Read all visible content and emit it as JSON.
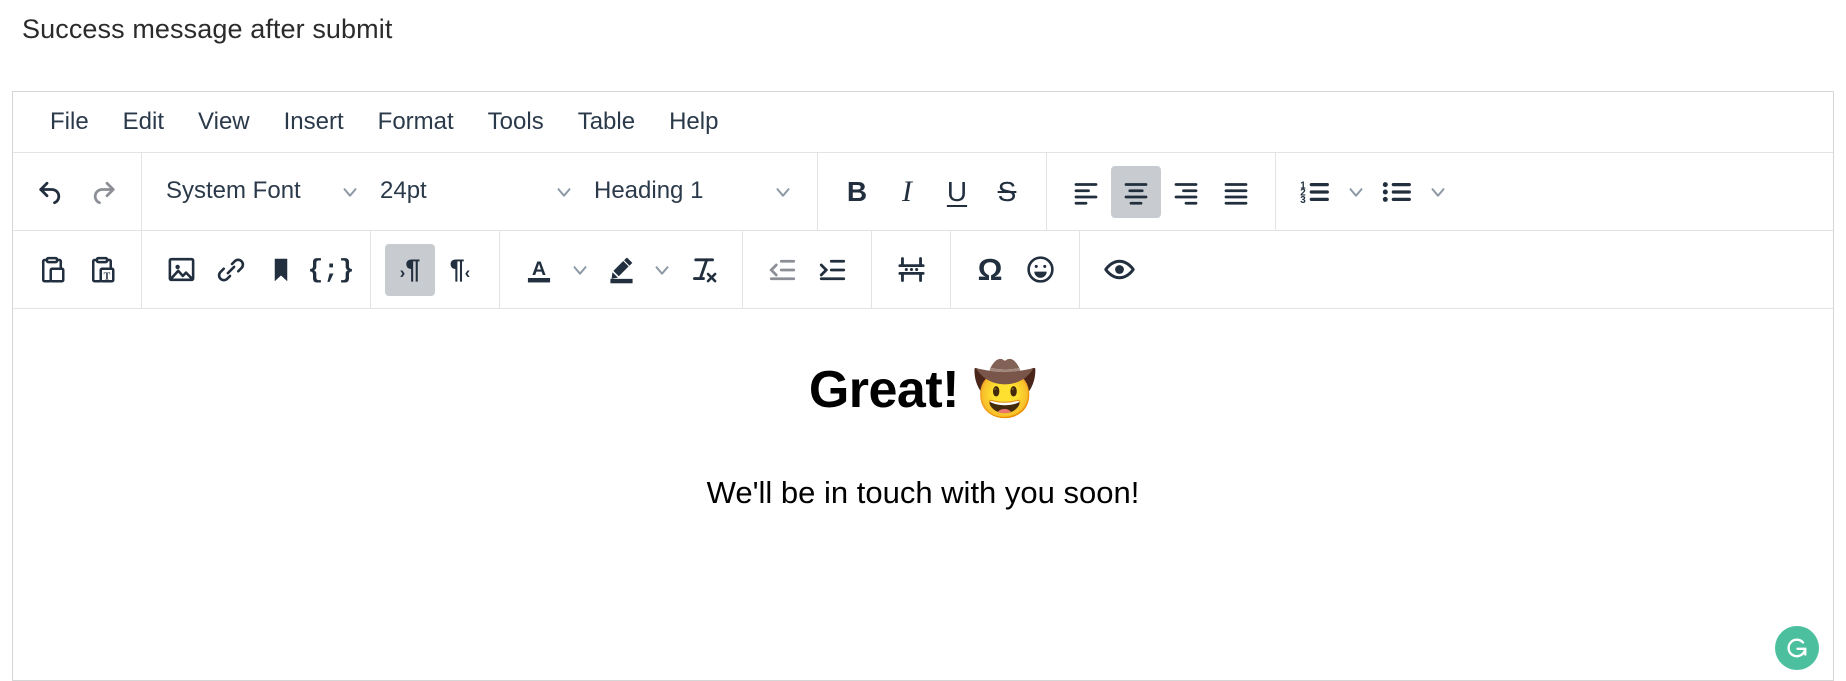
{
  "page": {
    "title": "Success message after submit"
  },
  "menubar": {
    "items": [
      {
        "label": "File",
        "name": "menu-file"
      },
      {
        "label": "Edit",
        "name": "menu-edit"
      },
      {
        "label": "View",
        "name": "menu-view"
      },
      {
        "label": "Insert",
        "name": "menu-insert"
      },
      {
        "label": "Format",
        "name": "menu-format"
      },
      {
        "label": "Tools",
        "name": "menu-tools"
      },
      {
        "label": "Table",
        "name": "menu-table"
      },
      {
        "label": "Help",
        "name": "menu-help"
      }
    ]
  },
  "toolbar_row1": {
    "undo_title": "Undo",
    "redo_title": "Redo",
    "font_family": "System Font",
    "font_size": "24pt",
    "block_format": "Heading 1",
    "bold": "B",
    "italic": "I",
    "underline": "U",
    "strikethrough": "S",
    "align_left": "Align left",
    "align_center": "Align center",
    "align_right": "Align right",
    "align_justify": "Justify",
    "numbered_list": "Numbered list",
    "bullet_list": "Bullet list",
    "active_alignment": "align-center"
  },
  "toolbar_row2": {
    "paste": "Paste",
    "paste_as_text": "Paste as text",
    "insert_image": "Insert image",
    "insert_link": "Insert link",
    "anchor": "Anchor",
    "source_code": "Source code",
    "ltr": "Left to right",
    "rtl": "Right to left",
    "text_color": "A",
    "background_color": "Background color",
    "clear_formatting": "Clear formatting",
    "outdent": "Decrease indent",
    "indent": "Increase indent",
    "horizontal_rule": "Horizontal line",
    "special_character": "Ω",
    "emoticons": "Emoticons",
    "preview": "Preview",
    "active_direction": "ltr",
    "disabled_buttons": [
      "outdent"
    ]
  },
  "content": {
    "heading": "Great! 🤠",
    "paragraph": "We'll be in touch with you soon!"
  },
  "badge": {
    "name": "grammarly-badge",
    "letter": "G",
    "color": "#4bbf9e"
  }
}
